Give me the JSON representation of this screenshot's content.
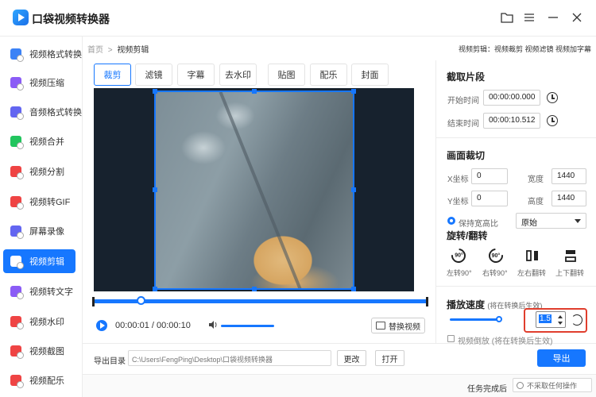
{
  "app": {
    "title": "口袋视频转换器"
  },
  "sidebar": {
    "items": [
      {
        "label": "视频格式转换",
        "color": "#3b82f6"
      },
      {
        "label": "视频压缩",
        "color": "#8b5cf6"
      },
      {
        "label": "音频格式转换",
        "color": "#6366f1"
      },
      {
        "label": "视频合并",
        "color": "#22c55e"
      },
      {
        "label": "视频分割",
        "color": "#ef4444"
      },
      {
        "label": "视频转GIF",
        "color": "#ef4444"
      },
      {
        "label": "屏幕录像",
        "color": "#6366f1"
      },
      {
        "label": "视频剪辑",
        "color": "#ffffff",
        "active": true
      },
      {
        "label": "视频转文字",
        "color": "#8b5cf6"
      },
      {
        "label": "视频水印",
        "color": "#ef4444"
      },
      {
        "label": "视频截图",
        "color": "#ef4444"
      },
      {
        "label": "视频配乐",
        "color": "#ef4444"
      }
    ]
  },
  "breadcrumb": {
    "home": "首页",
    "sep": ">",
    "current": "视频剪辑"
  },
  "top_links": "视频剪辑：视频裁剪 视频滤镜 视频加字幕",
  "tabs": [
    "裁剪",
    "滤镜",
    "字幕",
    "去水印",
    "贴图",
    "配乐",
    "封面"
  ],
  "player": {
    "time": "00:00:01 / 00:00:10",
    "replace_label": "替换视频"
  },
  "export": {
    "dir_label": "导出目录",
    "dir_path": "C:\\Users\\FengPing\\Desktop\\口袋视频转换器",
    "change_label": "更改",
    "open_label": "打开",
    "export_label": "导出"
  },
  "status": {
    "task_label": "任务完成后",
    "task_option": "不采取任何操作"
  },
  "clip": {
    "title": "截取片段",
    "start_label": "开始时间",
    "start_value": "00:00:00.000",
    "end_label": "结束时间",
    "end_value": "00:00:10.512"
  },
  "crop": {
    "title": "画面裁切",
    "x_label": "X坐标",
    "x_value": "0",
    "width_label": "宽度",
    "width_value": "1440",
    "y_label": "Y坐标",
    "y_value": "0",
    "height_label": "高度",
    "height_value": "1440",
    "keep_ratio_label": "保持宽高比",
    "ratio_option": "原始"
  },
  "rotate": {
    "title": "旋转/翻转",
    "left_label": "左转90°",
    "right_label": "右转90°",
    "flip_h_label": "左右翻转",
    "flip_v_label": "上下翻转",
    "icon_text": "90°"
  },
  "speed": {
    "title": "播放速度",
    "hint": "(将在转换后生效)",
    "value": "1.5",
    "level": 0.5,
    "reverse_label": "视频倒放",
    "reverse_hint": "(将在转换后生效)"
  }
}
